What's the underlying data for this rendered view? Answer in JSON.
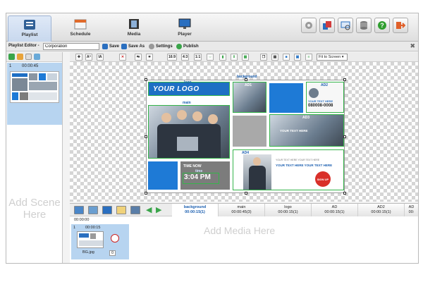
{
  "nav": {
    "tabs": [
      {
        "label": "Playlist",
        "icon": "playlist-icon",
        "active": true
      },
      {
        "label": "Schedule",
        "icon": "calendar-icon"
      },
      {
        "label": "Media",
        "icon": "film-icon"
      },
      {
        "label": "Player",
        "icon": "monitor-icon"
      }
    ],
    "tools": [
      "settings-gear-icon",
      "layers-icon",
      "screens-icon",
      "database-icon",
      "help-icon",
      "logout-icon"
    ]
  },
  "editor": {
    "label": "Playlist Editor -",
    "name_value": "Corporation",
    "save": "Save",
    "save_as": "Save As",
    "settings": "Settings",
    "publish": "Publish",
    "close": "✖"
  },
  "scenes": {
    "items": [
      {
        "num": "1",
        "time": "00:00:45"
      }
    ],
    "add_label": "Add Scene Here"
  },
  "canvas": {
    "tool_labels": [
      "16:9",
      "4:3",
      "1:1"
    ],
    "fit_option": "Fit to Screen",
    "regions": {
      "background": "background",
      "logo": "logo",
      "main": "main",
      "ad1": "AD1",
      "ad2": "AD2",
      "ad3": "AD3",
      "ad4": "AD4",
      "time": "time"
    },
    "logo_text": "YOUR LOGO",
    "ad2_text": {
      "title": "YOUR TEXT HERE",
      "phone": "080008-0008"
    },
    "ad3_text": "YOUR TEXT HERE",
    "ad4_text": {
      "headline": "YOUR TEXT HERE YOUR TEXT HERE",
      "sub": "YOUR TEXT HERE YOUR TEXT HERE",
      "sign": "SIGN UP"
    },
    "time_now_label": "TIME NOW",
    "time_value": "3:04 PM"
  },
  "timeline": {
    "tracks": [
      {
        "name": "background",
        "time": "00:00:15(1)",
        "active": true
      },
      {
        "name": "main",
        "time": "00:00:45(3)"
      },
      {
        "name": "logo",
        "time": "00:00:15(1)"
      },
      {
        "name": "AD",
        "time": "00:00:15(1)"
      },
      {
        "name": "AD2",
        "time": "00:00:15(1)"
      },
      {
        "name": "AD",
        "time": "00:"
      }
    ],
    "group_time": "00:00:00",
    "media": {
      "num": "1",
      "time": "00:00:15",
      "file": "BG.jpg",
      "count": "0"
    },
    "add_media_label": "Add Media Here"
  },
  "colors": {
    "accent": "#1e7ad6",
    "region_border": "#35b54a",
    "selection": "#b7d4f0"
  }
}
